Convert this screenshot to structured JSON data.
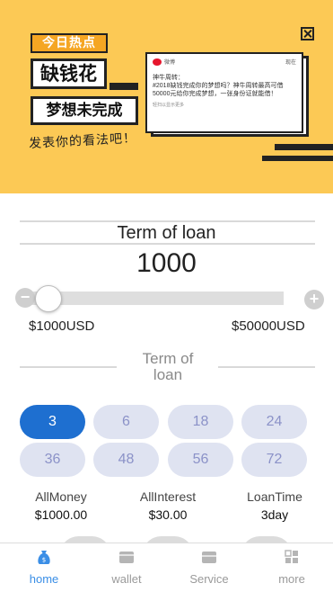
{
  "banner": {
    "tag": "今日热点",
    "headline1": "缺钱花",
    "headline2": "梦想未完成",
    "slogan": "发表你的看法吧！",
    "card": {
      "app_name": "微博",
      "action": "现在",
      "user": "神牛周转：",
      "body": "#2018缺钱完成你的梦想吗？神牛周转最高可借50000元给你完成梦想，一张身份证就能借！",
      "footer": "轻扫以显示更多"
    }
  },
  "loan": {
    "title": "Term of loan",
    "amount": "1000",
    "slider_level": 0.0,
    "min_label": "$1000USD",
    "max_label": "$50000USD",
    "minus_symbol": "−",
    "plus_symbol": "+"
  },
  "term": {
    "title_line1": "Term of",
    "title_line2": "loan",
    "options": [
      "3",
      "6",
      "18",
      "24",
      "36",
      "48",
      "56",
      "72"
    ],
    "selected": "3"
  },
  "summary": {
    "all_money_label": "AllMoney",
    "all_money_value": "$1000.00",
    "all_interest_label": "AllInterest",
    "all_interest_value": "$30.00",
    "loan_time_label": "LoanTime",
    "loan_time_value": "3day"
  },
  "tabs": [
    {
      "label": "home",
      "icon": "money-bag-icon",
      "active": true
    },
    {
      "label": "wallet",
      "icon": "wallet-icon",
      "active": false
    },
    {
      "label": "Service",
      "icon": "service-icon",
      "active": false
    },
    {
      "label": "more",
      "icon": "grid-icon",
      "active": false
    }
  ],
  "colors": {
    "banner_bg": "#fcc955",
    "accent_blue": "#1e6fd0",
    "option_bg": "#dfe3f1",
    "option_text": "#8b92c8",
    "active_tab": "#3a8ee6"
  }
}
